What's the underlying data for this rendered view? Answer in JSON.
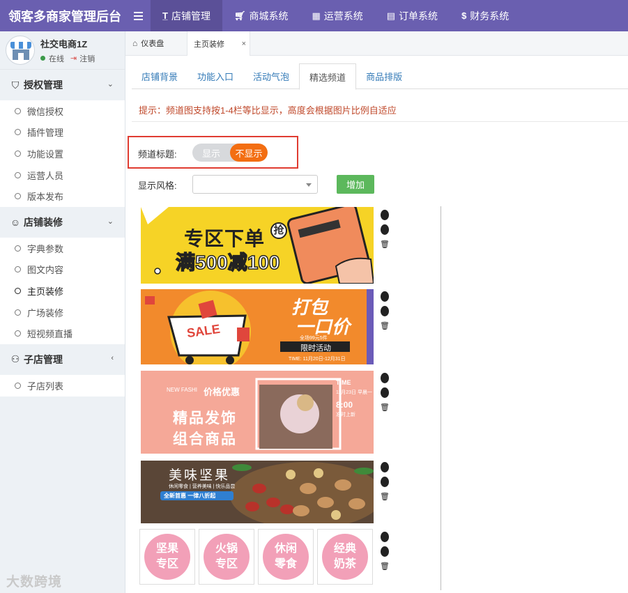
{
  "app": {
    "title": "领客多商家管理后台"
  },
  "topnav": [
    {
      "icon": "T",
      "label": "店铺管理"
    },
    {
      "icon": "cart",
      "label": "商城系统"
    },
    {
      "icon": "grid",
      "label": "运营系统"
    },
    {
      "icon": "list",
      "label": "订单系统"
    },
    {
      "icon": "$",
      "label": "财务系统"
    }
  ],
  "user": {
    "name": "社交电商1Z",
    "status": "在线",
    "logout": "注销"
  },
  "sidebar": {
    "groups": [
      {
        "label": "授权管理",
        "icon": "shield-icon",
        "items": [
          "微信授权",
          "插件管理",
          "功能设置",
          "运营人员",
          "版本发布"
        ]
      },
      {
        "label": "店铺装修",
        "icon": "smile-icon",
        "items": [
          "字典参数",
          "图文内容",
          "主页装修",
          "广场装修",
          "短视频直播"
        ]
      },
      {
        "label": "子店管理",
        "icon": "users-icon",
        "items": [
          "子店列表"
        ]
      }
    ]
  },
  "pagetabs": {
    "home": "仪表盘",
    "current": "主页装修",
    "close": "×"
  },
  "content_tabs": [
    "店铺背景",
    "功能入口",
    "活动气泡",
    "精选频道",
    "商品排版"
  ],
  "notice": "提示：频道图支持按1-4栏等比显示，高度会根据图片比例自适应",
  "form": {
    "channel_title_label": "频道标题:",
    "toggle_show": "显示",
    "toggle_hide": "不显示",
    "style_label": "显示风格:",
    "style_value": "",
    "add_button": "增加"
  },
  "banners": {
    "b1": {
      "line1": "专区下单",
      "tag": "抢",
      "line2": "满500减100"
    },
    "b2": {
      "title1": "打包",
      "title2": "一口价",
      "sub": "全场99元5件",
      "badge": "限时活动",
      "time": "TIME: 11月20日-12月31日",
      "sale": "SALE"
    },
    "b3": {
      "en": "NEW FASHI",
      "tag": "价格优惠",
      "line1": "精品发饰",
      "line2": "组合商品",
      "time_label": "TIME",
      "date": "11月23日 早晨一",
      "clock": "8:00",
      "note": "准时上新"
    },
    "b4": {
      "title": "美味坚果",
      "sub": "休闲零食 | 营养美味 | 快乐品尝",
      "promo": "全新首惠 一律八折起"
    }
  },
  "icon_cards": [
    {
      "line1": "坚果",
      "line2": "专区"
    },
    {
      "line1": "火锅",
      "line2": "专区"
    },
    {
      "line1": "休闲",
      "line2": "零食"
    },
    {
      "line1": "经典",
      "line2": "奶茶"
    }
  ],
  "watermark": "大数跨境"
}
